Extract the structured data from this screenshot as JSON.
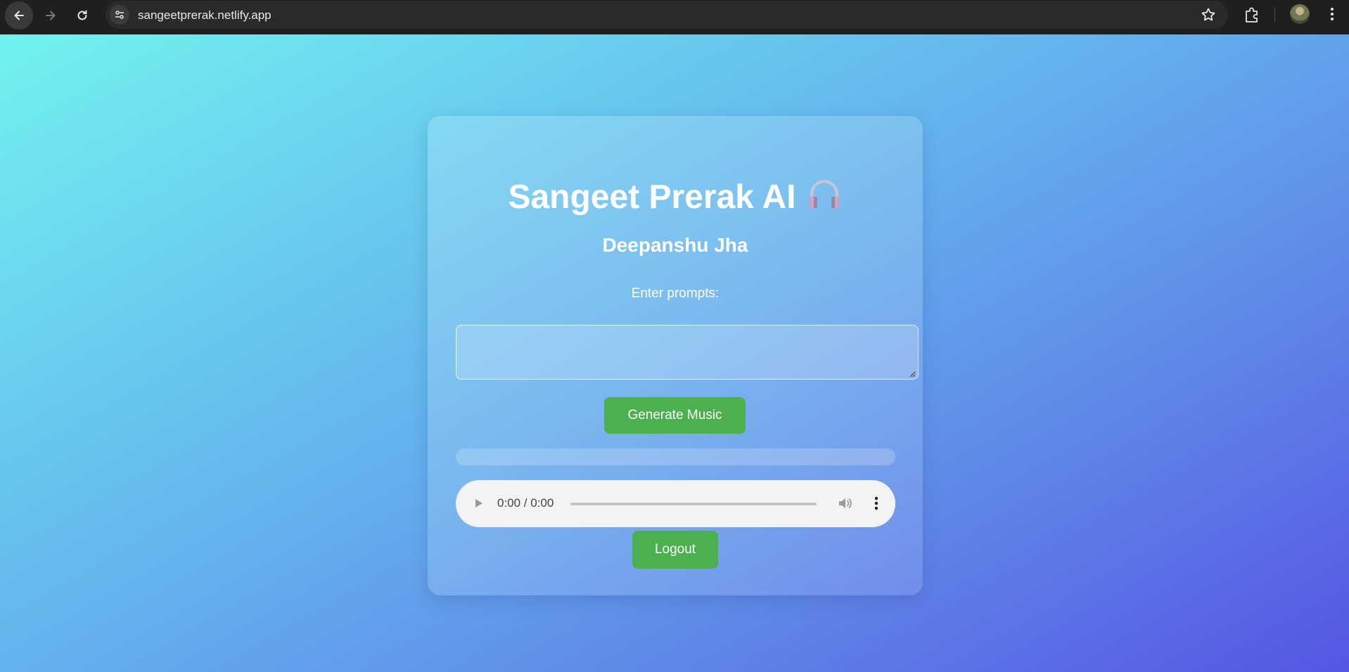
{
  "browser": {
    "url": "sangeetprerak.netlify.app",
    "icons": [
      "back-arrow-icon",
      "forward-arrow-icon",
      "reload-icon",
      "site-info-icon",
      "star-icon",
      "extensions-icon",
      "profile-avatar",
      "kebab-menu-icon"
    ]
  },
  "app": {
    "title": "Sangeet Prerak AI",
    "title_icon": "headphones-icon",
    "subtitle": "Deepanshu Jha",
    "prompt_label": "Enter prompts:",
    "prompt_value": "",
    "generate_label": "Generate Music",
    "progress_percent": 0,
    "logout_label": "Logout"
  },
  "audio_player": {
    "time_display": "0:00 / 0:00",
    "icons": [
      "play-icon",
      "volume-icon",
      "more-options-icon"
    ]
  },
  "colors": {
    "button_green": "#4caf50",
    "gradient_start": "#72f2ef",
    "gradient_end": "#5656e3"
  }
}
